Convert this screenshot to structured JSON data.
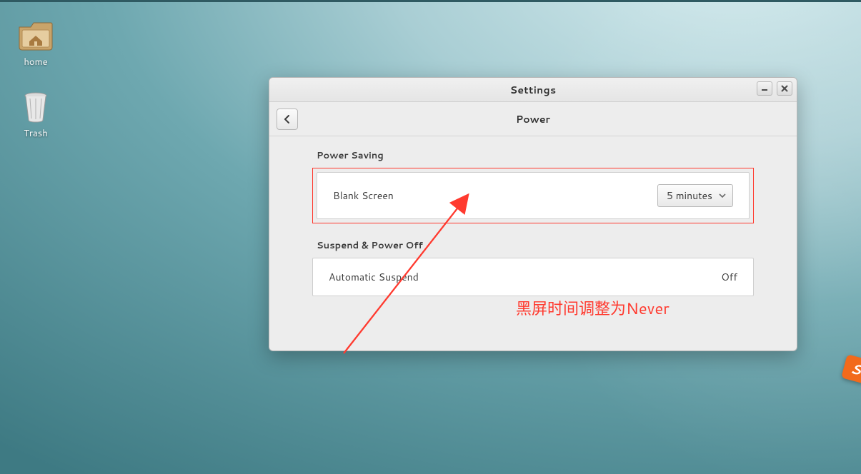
{
  "desktop": {
    "icons": {
      "home": {
        "label": "home"
      },
      "trash": {
        "label": "Trash"
      }
    }
  },
  "window": {
    "title": "Settings",
    "subtitle": "Power",
    "sections": {
      "power_saving": {
        "heading": "Power Saving",
        "blank_screen_label": "Blank Screen",
        "blank_screen_value": "5 minutes"
      },
      "suspend": {
        "heading": "Suspend & Power Off",
        "auto_suspend_label": "Automatic Suspend",
        "auto_suspend_value": "Off"
      }
    }
  },
  "annotation": {
    "text": "黑屏时间调整为Never",
    "color": "#ff3a2f"
  },
  "badge": {
    "letter": "S"
  }
}
